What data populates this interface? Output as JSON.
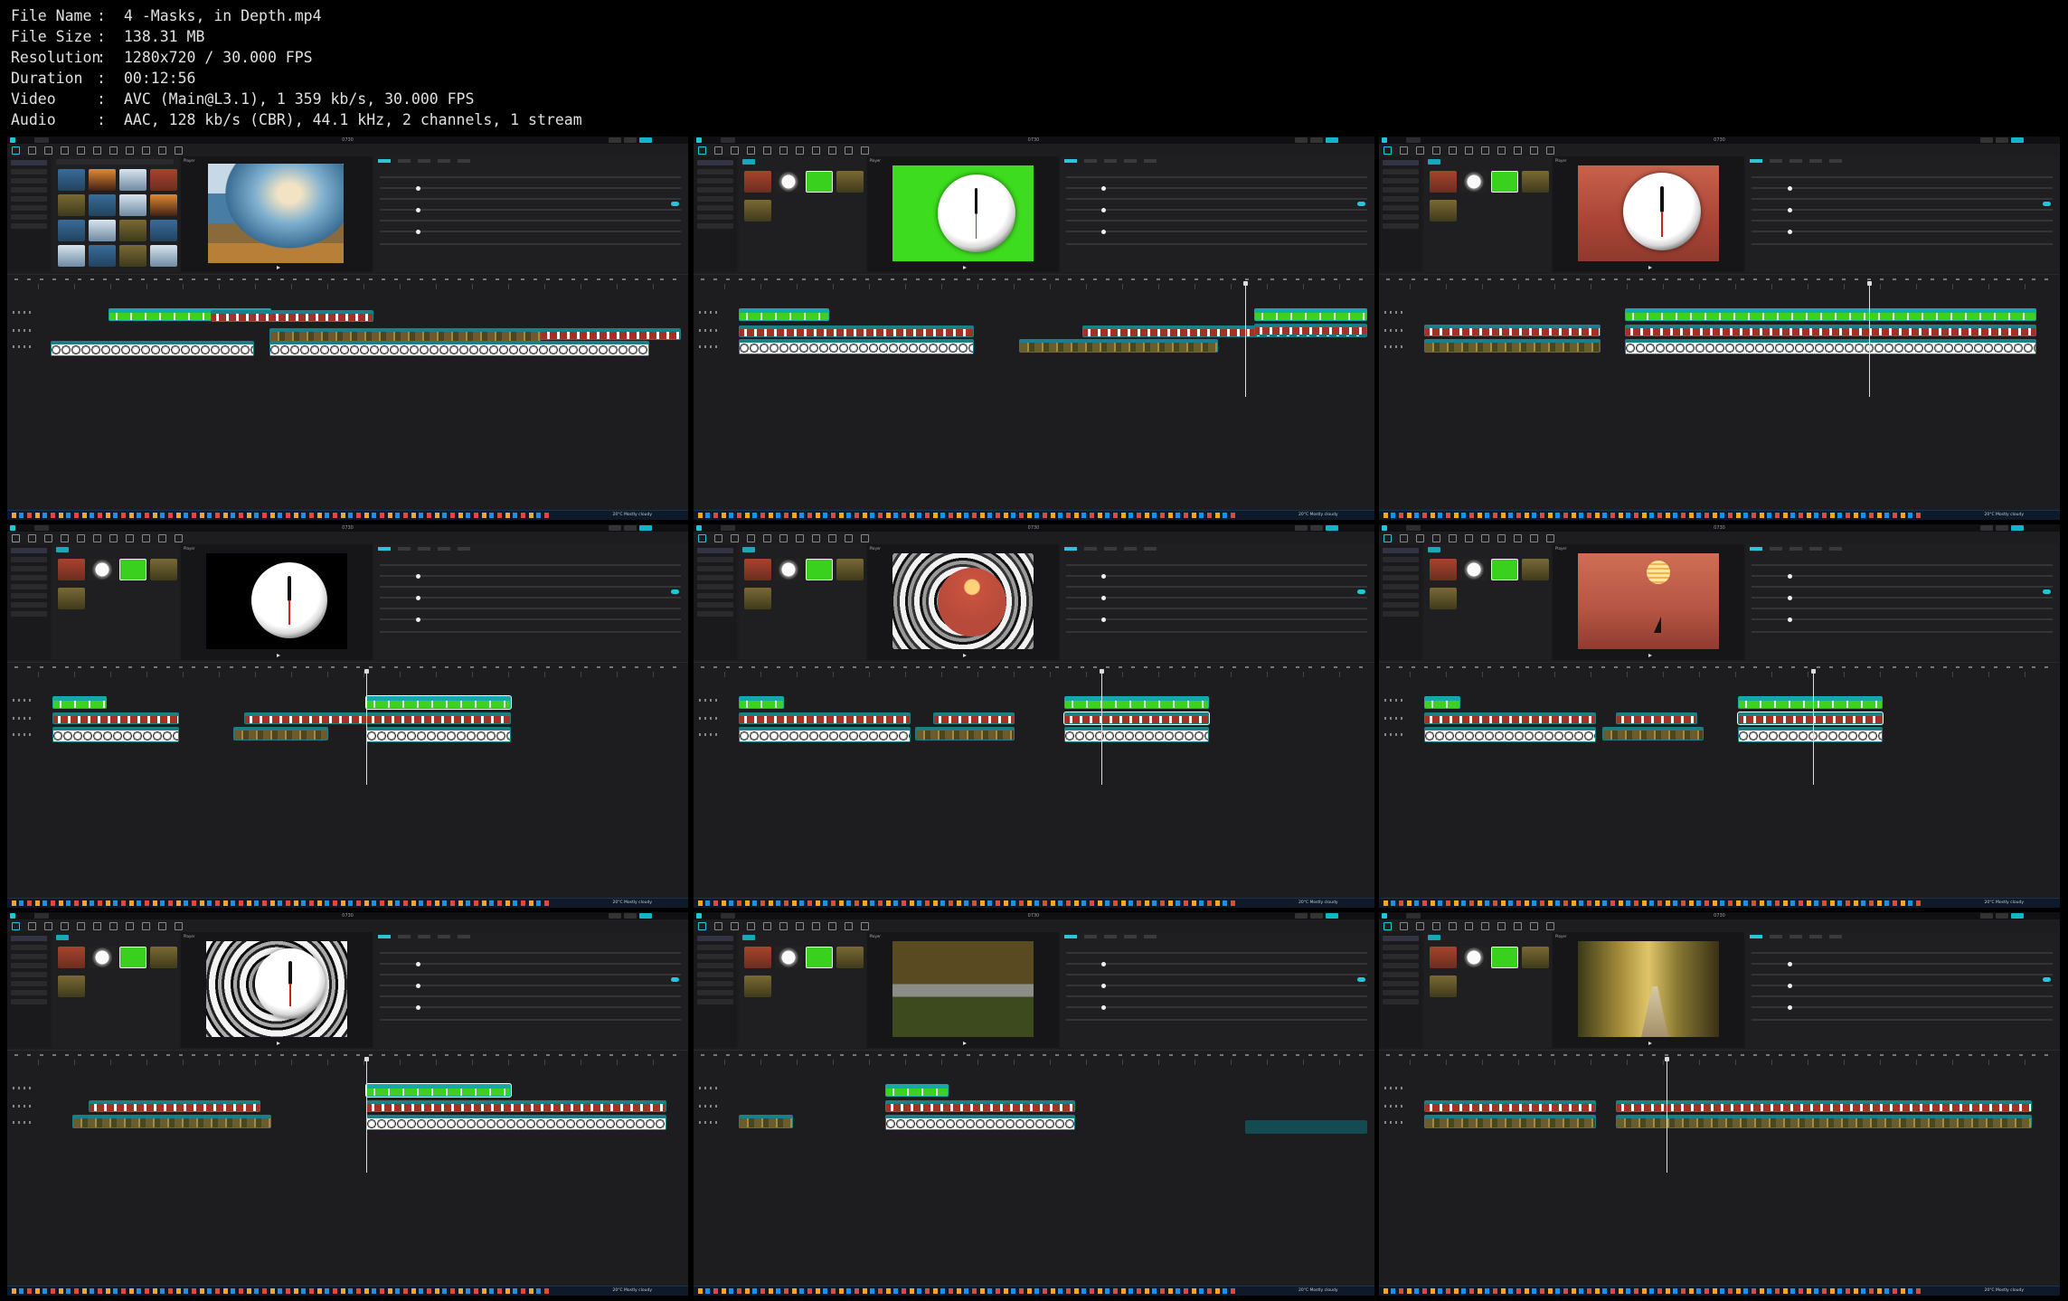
{
  "file_info": [
    {
      "key": "File Name",
      "value": "4 -Masks, in Depth.mp4"
    },
    {
      "key": "File Size",
      "value": "138.31 MB"
    },
    {
      "key": "Resolution",
      "value": "1280x720 / 30.000 FPS"
    },
    {
      "key": "Duration",
      "value": "00:12:56"
    },
    {
      "key": "Video",
      "value": "AVC (Main@L3.1), 1 359 kb/s, 30.000 FPS"
    },
    {
      "key": "Audio",
      "value": "AAC, 128 kb/s (CBR), 44.1 kHz, 2 channels, 1 stream"
    }
  ],
  "separator": ":",
  "app": {
    "window_title": "0730",
    "menu_label": "Menu",
    "player_label": "Player",
    "details_label": "Details",
    "export_label": "Export"
  },
  "taskbar": {
    "weather": "20°C Mostly cloudy"
  },
  "colors": {
    "accent": "#1ec8d8",
    "green_screen": "#39d11d",
    "clip_teal": "#1b7f85",
    "background": "#000000"
  },
  "panels": [
    {
      "preview": "landscape",
      "view": "library"
    },
    {
      "preview": "green_clock"
    },
    {
      "preview": "sunset_clock"
    },
    {
      "preview": "black_clock"
    },
    {
      "preview": "tunnel_sun"
    },
    {
      "preview": "sunset_boat"
    },
    {
      "preview": "tunnel_clock"
    },
    {
      "preview": "aerial_road"
    },
    {
      "preview": "forest_path"
    }
  ]
}
